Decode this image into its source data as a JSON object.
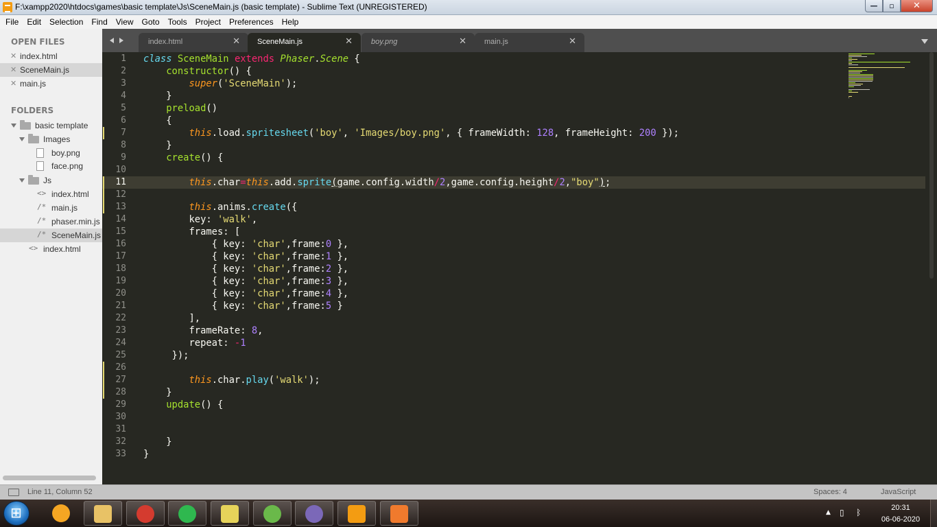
{
  "window": {
    "title": "F:\\xampp2020\\htdocs\\games\\basic template\\Js\\SceneMain.js (basic template) - Sublime Text (UNREGISTERED)",
    "controls": {
      "minimize": "—",
      "maximize": "▫",
      "close": "✕"
    }
  },
  "menu": [
    "File",
    "Edit",
    "Selection",
    "Find",
    "View",
    "Goto",
    "Tools",
    "Project",
    "Preferences",
    "Help"
  ],
  "sidebar": {
    "open_files_title": "OPEN FILES",
    "open_files": [
      {
        "name": "index.html",
        "selected": false
      },
      {
        "name": "SceneMain.js",
        "selected": true
      },
      {
        "name": "main.js",
        "selected": false
      }
    ],
    "folders_title": "FOLDERS",
    "tree": {
      "root": "basic template",
      "images_folder": "Images",
      "images": [
        "boy.png",
        "face.png"
      ],
      "js_folder": "Js",
      "js_files": [
        {
          "name": "index.html",
          "icon": "<>"
        },
        {
          "name": "main.js",
          "icon": "/*"
        },
        {
          "name": "phaser.min.js",
          "icon": "/*"
        },
        {
          "name": "SceneMain.js",
          "icon": "/*"
        }
      ],
      "root_files": [
        {
          "name": "index.html",
          "icon": "<>"
        }
      ]
    }
  },
  "tabs": [
    {
      "label": "index.html",
      "active": false,
      "preview": false
    },
    {
      "label": "SceneMain.js",
      "active": true,
      "preview": false
    },
    {
      "label": "boy.png",
      "active": false,
      "preview": true
    },
    {
      "label": "main.js",
      "active": false,
      "preview": false
    }
  ],
  "tab_close_glyph": "✕",
  "editor": {
    "current_line": 11,
    "lines": [
      [
        [
          "kw-store",
          "class"
        ],
        [
          "pl",
          " "
        ],
        [
          "cls",
          "SceneMain"
        ],
        [
          "pl",
          " "
        ],
        [
          "kw",
          "extends"
        ],
        [
          "pl",
          " "
        ],
        [
          "inh",
          "Phaser"
        ],
        [
          "pl",
          "."
        ],
        [
          "inh",
          "Scene"
        ],
        [
          "pl",
          " {"
        ]
      ],
      [
        [
          "pl",
          "    "
        ],
        [
          "cls",
          "constructor"
        ],
        [
          "pl",
          "() {"
        ]
      ],
      [
        [
          "pl",
          "        "
        ],
        [
          "th",
          "super"
        ],
        [
          "pl",
          "("
        ],
        [
          "s",
          "'SceneMain'"
        ],
        [
          "pl",
          ");"
        ]
      ],
      [
        [
          "pl",
          "    }"
        ]
      ],
      [
        [
          "pl",
          "    "
        ],
        [
          "cls",
          "preload"
        ],
        [
          "pl",
          "()"
        ]
      ],
      [
        [
          "pl",
          "    {"
        ]
      ],
      [
        [
          "pl",
          "        "
        ],
        [
          "th",
          "this"
        ],
        [
          "pl",
          ".load."
        ],
        [
          "fn",
          "spritesheet"
        ],
        [
          "pl",
          "("
        ],
        [
          "s",
          "'boy'"
        ],
        [
          "pl",
          ", "
        ],
        [
          "s",
          "'Images/boy.png'"
        ],
        [
          "pl",
          ", { frameWidth: "
        ],
        [
          "n",
          "128"
        ],
        [
          "pl",
          ", frameHeight: "
        ],
        [
          "n",
          "200"
        ],
        [
          "pl",
          " });"
        ]
      ],
      [
        [
          "pl",
          "    }"
        ]
      ],
      [
        [
          "pl",
          "    "
        ],
        [
          "cls",
          "create"
        ],
        [
          "pl",
          "() {"
        ]
      ],
      [
        [
          "pl",
          ""
        ]
      ],
      [
        [
          "pl",
          "        "
        ],
        [
          "th",
          "this"
        ],
        [
          "pl",
          ".char"
        ],
        [
          "op",
          "="
        ],
        [
          "th",
          "this"
        ],
        [
          "pl",
          ".add."
        ],
        [
          "fn",
          "sprite"
        ],
        [
          "pu",
          "("
        ],
        [
          "pl",
          "game.config.width"
        ],
        [
          "op",
          "/"
        ],
        [
          "n",
          "2"
        ],
        [
          "pl",
          ",game.config.height"
        ],
        [
          "op",
          "/"
        ],
        [
          "n",
          "2"
        ],
        [
          "pl",
          ","
        ],
        [
          "s",
          "\"boy\""
        ],
        [
          "pu",
          ")"
        ],
        [
          "pl",
          ";"
        ]
      ],
      [
        [
          "pl",
          ""
        ]
      ],
      [
        [
          "pl",
          "        "
        ],
        [
          "th",
          "this"
        ],
        [
          "pl",
          ".anims."
        ],
        [
          "fn",
          "create"
        ],
        [
          "pl",
          "({"
        ]
      ],
      [
        [
          "pl",
          "        key: "
        ],
        [
          "s",
          "'walk'"
        ],
        [
          "pl",
          ","
        ]
      ],
      [
        [
          "pl",
          "        frames: ["
        ]
      ],
      [
        [
          "pl",
          "            { key: "
        ],
        [
          "s",
          "'char'"
        ],
        [
          "pl",
          ",frame:"
        ],
        [
          "n",
          "0"
        ],
        [
          "pl",
          " },"
        ]
      ],
      [
        [
          "pl",
          "            { key: "
        ],
        [
          "s",
          "'char'"
        ],
        [
          "pl",
          ",frame:"
        ],
        [
          "n",
          "1"
        ],
        [
          "pl",
          " },"
        ]
      ],
      [
        [
          "pl",
          "            { key: "
        ],
        [
          "s",
          "'char'"
        ],
        [
          "pl",
          ",frame:"
        ],
        [
          "n",
          "2"
        ],
        [
          "pl",
          " },"
        ]
      ],
      [
        [
          "pl",
          "            { key: "
        ],
        [
          "s",
          "'char'"
        ],
        [
          "pl",
          ",frame:"
        ],
        [
          "n",
          "3"
        ],
        [
          "pl",
          " },"
        ]
      ],
      [
        [
          "pl",
          "            { key: "
        ],
        [
          "s",
          "'char'"
        ],
        [
          "pl",
          ",frame:"
        ],
        [
          "n",
          "4"
        ],
        [
          "pl",
          " },"
        ]
      ],
      [
        [
          "pl",
          "            { key: "
        ],
        [
          "s",
          "'char'"
        ],
        [
          "pl",
          ",frame:"
        ],
        [
          "n",
          "5"
        ],
        [
          "pl",
          " }"
        ]
      ],
      [
        [
          "pl",
          "        ],"
        ]
      ],
      [
        [
          "pl",
          "        frameRate: "
        ],
        [
          "n",
          "8"
        ],
        [
          "pl",
          ","
        ]
      ],
      [
        [
          "pl",
          "        repeat: "
        ],
        [
          "op",
          "-"
        ],
        [
          "n",
          "1"
        ]
      ],
      [
        [
          "pl",
          "     });"
        ]
      ],
      [
        [
          "pl",
          ""
        ]
      ],
      [
        [
          "pl",
          "        "
        ],
        [
          "th",
          "this"
        ],
        [
          "pl",
          ".char."
        ],
        [
          "fn",
          "play"
        ],
        [
          "pl",
          "("
        ],
        [
          "s",
          "'walk'"
        ],
        [
          "pl",
          ");"
        ]
      ],
      [
        [
          "pl",
          "    }"
        ]
      ],
      [
        [
          "pl",
          "    "
        ],
        [
          "cls",
          "update"
        ],
        [
          "pl",
          "() {"
        ]
      ],
      [
        [
          "pl",
          ""
        ]
      ],
      [
        [
          "pl",
          ""
        ]
      ],
      [
        [
          "pl",
          "    }"
        ]
      ],
      [
        [
          "pl",
          "}"
        ]
      ]
    ],
    "modified_lines": [
      7,
      11,
      26
    ]
  },
  "status": {
    "position": "Line 11, Column 52",
    "indent": "Spaces: 4",
    "syntax": "JavaScript"
  },
  "taskbar": {
    "apps": [
      "windows-media-player",
      "file-explorer",
      "google-chrome",
      "chat-app",
      "sticky-notes",
      "utorrent",
      "bittorrent",
      "sublime-text",
      "xampp"
    ],
    "clock_time": "20:31",
    "clock_date": "06-06-2020"
  },
  "colors": {
    "editor_bg": "#272822",
    "keyword": "#f92672",
    "string": "#e6db74",
    "number": "#ae81ff",
    "function": "#66d9ef",
    "class": "#a6e22e",
    "this": "#fd971f"
  }
}
